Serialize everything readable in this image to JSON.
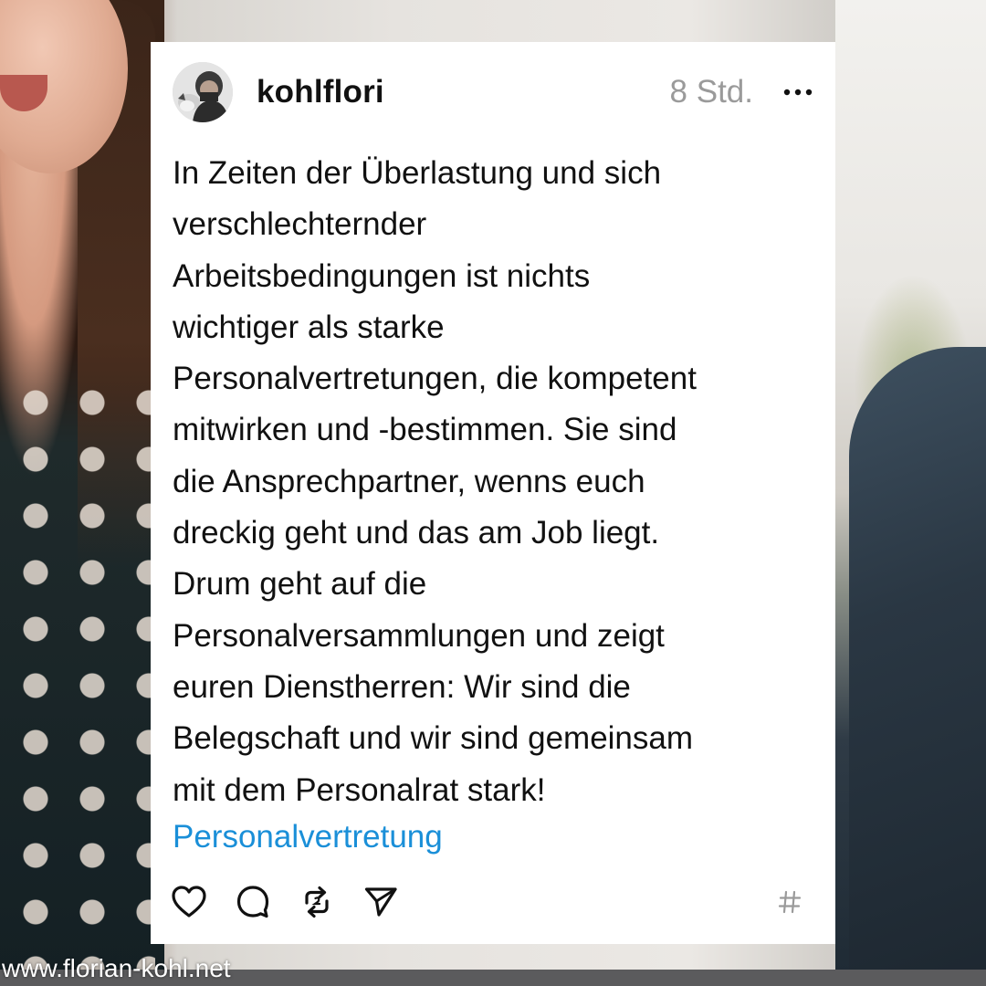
{
  "post": {
    "username": "kohlflori",
    "timestamp": "8 Std.",
    "body_lines": [
      "In Zeiten der Überlastung und sich",
      "verschlechternder",
      "Arbeitsbedingungen ist nichts",
      "wichtiger als starke",
      "Personalvertretungen, die kompetent",
      "mitwirken und -bestimmen. Sie sind",
      "die Ansprechpartner, wenns euch",
      "dreckig geht und das am Job liegt.",
      "Drum geht auf die",
      "Personalversammlungen und zeigt",
      "euren Dienstherren: Wir sind die",
      "Belegschaft und wir sind gemeinsam",
      "mit dem Personalrat stark!"
    ],
    "hashtag": "Personalvertretung",
    "icons": {
      "more": "more-options-icon",
      "like": "heart-icon",
      "reply": "comment-icon",
      "repost": "repost-icon",
      "share": "send-icon",
      "tag": "hashtag-icon"
    }
  },
  "watermark": "www.florian-kohl.net",
  "colors": {
    "card_background": "#ffffff",
    "text": "#111111",
    "timestamp": "#9a9a9a",
    "hashtag_link": "#1a8fd8",
    "icon": "#111111",
    "tag_icon": "#9a9a9a"
  }
}
